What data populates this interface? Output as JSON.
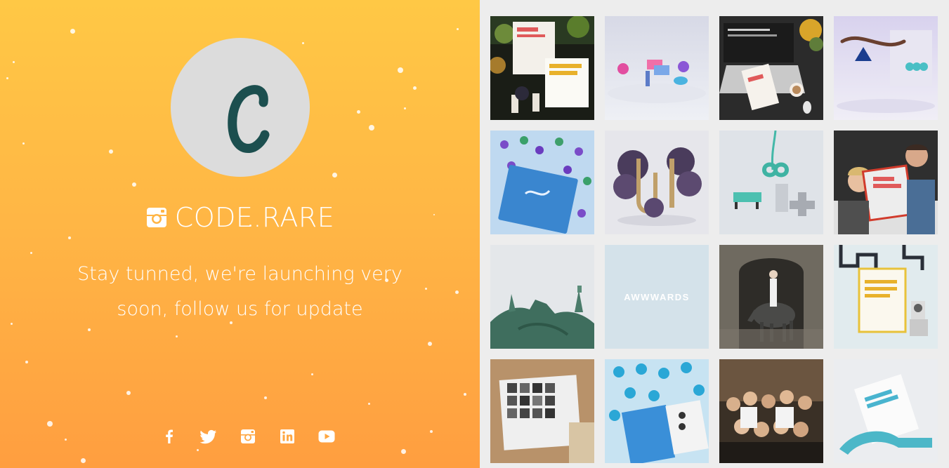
{
  "brand": {
    "logo_letter": "C",
    "name": "CODE.RARE",
    "tagline_line1": "Stay tunned, we're launching very",
    "tagline_line2": "soon, follow us for update"
  },
  "social": [
    {
      "name": "facebook-icon"
    },
    {
      "name": "twitter-icon"
    },
    {
      "name": "instagram-icon"
    },
    {
      "name": "linkedin-icon"
    },
    {
      "name": "youtube-icon"
    }
  ],
  "gallery": {
    "tiles": [
      {
        "subject": "award-posters-with-plants"
      },
      {
        "subject": "3d-shapes-pink-blue"
      },
      {
        "subject": "laptop-with-site-of-day-poster"
      },
      {
        "subject": "floating-wave-shape"
      },
      {
        "subject": "blue-book-with-petals"
      },
      {
        "subject": "ui-letters-with-flowers"
      },
      {
        "subject": "infinity-teal-shape"
      },
      {
        "subject": "people-holding-poster"
      },
      {
        "subject": "statue-of-liberty"
      },
      {
        "subject": "awwwards-card",
        "label": "AWWWARDS"
      },
      {
        "subject": "horse-rider-in-doorway"
      },
      {
        "subject": "honorable-mention-poster"
      },
      {
        "subject": "photo-book-portraits"
      },
      {
        "subject": "blue-book-with-umbrellas"
      },
      {
        "subject": "team-group-photo"
      },
      {
        "subject": "site-of-month-paper"
      }
    ]
  },
  "colors": {
    "gradient_top": "#ffc845",
    "gradient_bottom": "#ff9e40",
    "logo_letter": "#1c4f4f",
    "logo_bg": "#dcdcdc"
  }
}
